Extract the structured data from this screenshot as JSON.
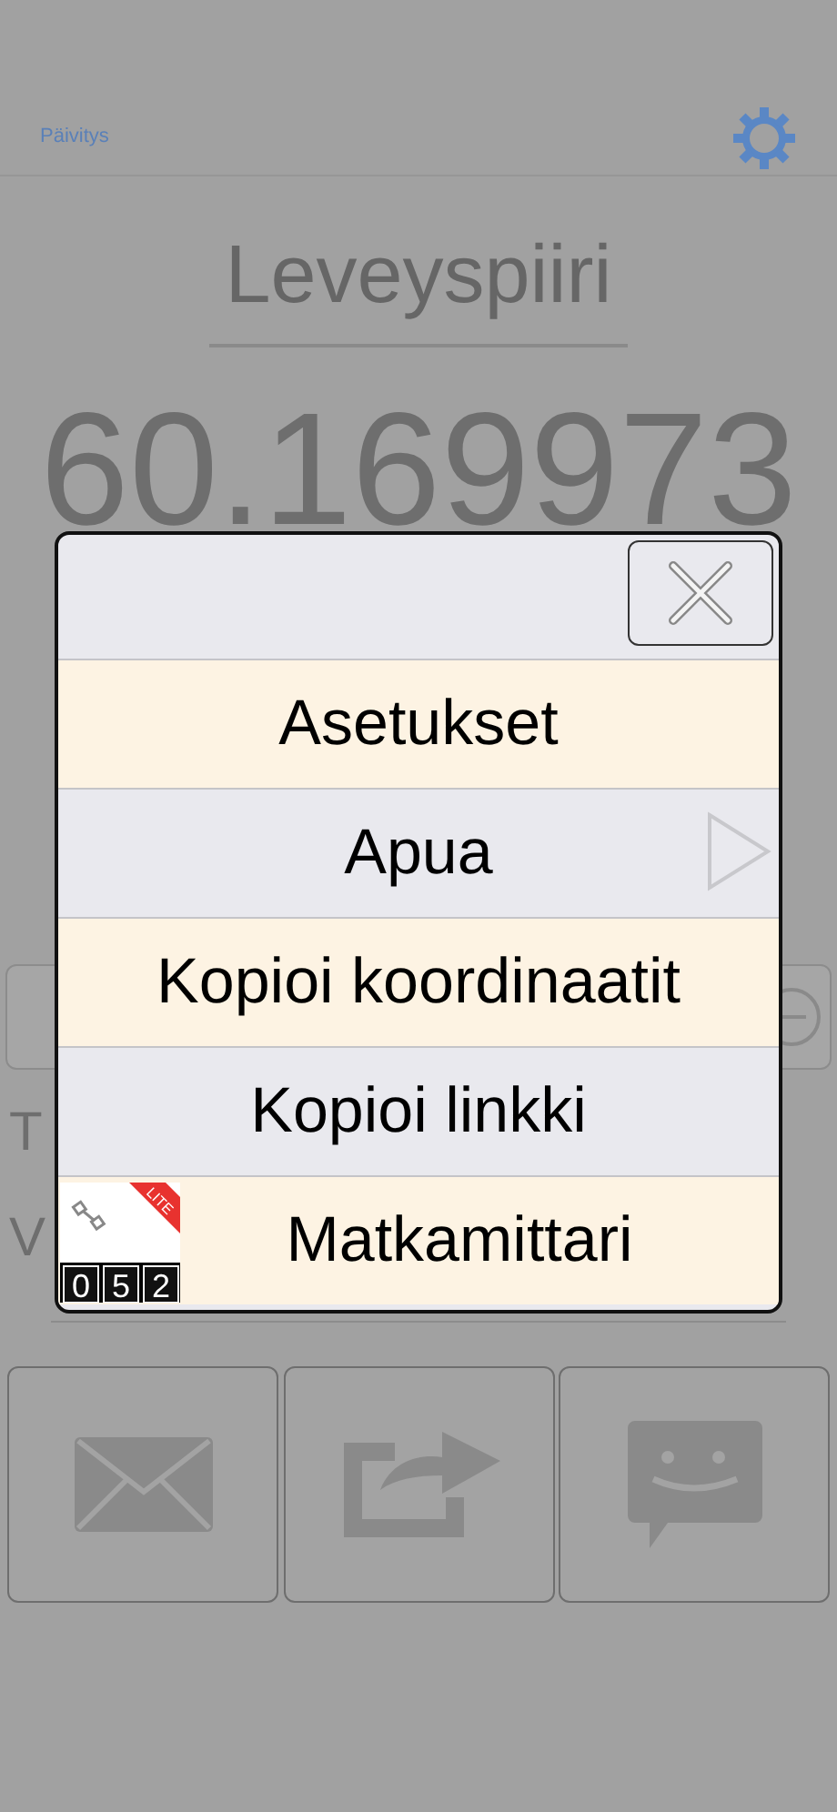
{
  "top_bar": {
    "refresh_link": "Päivitys"
  },
  "title": "Leveyspiiri",
  "latitude": "60.169973",
  "labels": [
    "T",
    "V"
  ],
  "share_buttons": [
    {
      "kind": "mail"
    },
    {
      "kind": "share"
    },
    {
      "kind": "message"
    }
  ],
  "menu": {
    "items": [
      {
        "label": "Asetukset",
        "kind": "plain"
      },
      {
        "label": "Apua",
        "kind": "submenu"
      },
      {
        "label": "Kopioi koordinaatit",
        "kind": "plain"
      },
      {
        "label": "Kopioi linkki",
        "kind": "plain"
      },
      {
        "label": "Matkamittari",
        "kind": "app",
        "app_icon": {
          "ribbon": "LITE",
          "digits": [
            "0",
            "5",
            "2"
          ]
        }
      }
    ]
  }
}
